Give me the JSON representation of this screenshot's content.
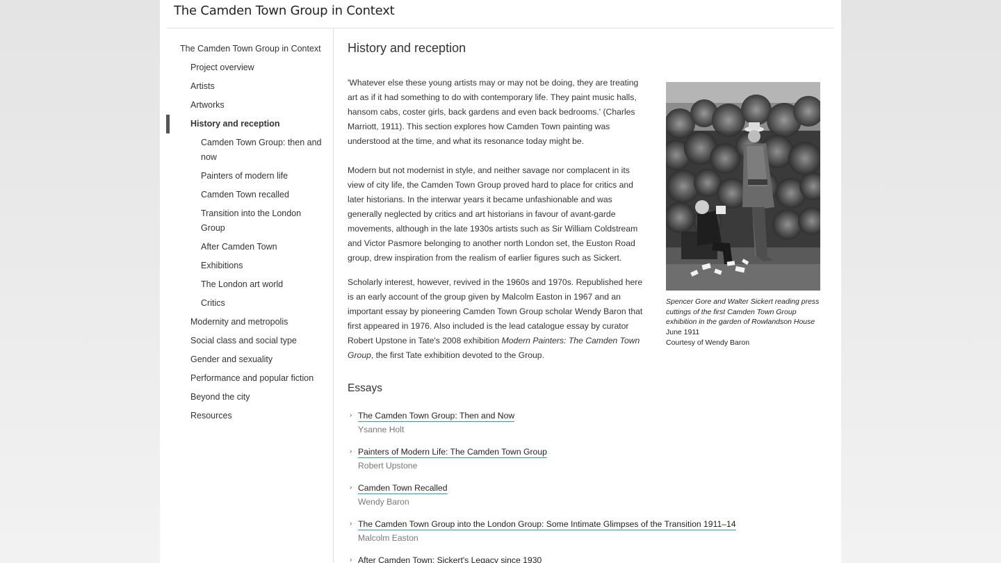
{
  "site": {
    "title": "The Camden Town Group in Context"
  },
  "sidebar": {
    "items": [
      {
        "label": "The Camden Town Group in Context",
        "level": 0
      },
      {
        "label": "Project overview",
        "level": 1
      },
      {
        "label": "Artists",
        "level": 1
      },
      {
        "label": "Artworks",
        "level": 1
      },
      {
        "label": "History and reception",
        "level": 1,
        "active": true
      },
      {
        "label": "Camden Town Group: then and now",
        "level": 2
      },
      {
        "label": "Painters of modern life",
        "level": 2
      },
      {
        "label": "Camden Town recalled",
        "level": 2
      },
      {
        "label": "Transition into the London Group",
        "level": 2
      },
      {
        "label": "After Camden Town",
        "level": 2
      },
      {
        "label": "Exhibitions",
        "level": 2
      },
      {
        "label": "The London art world",
        "level": 2
      },
      {
        "label": "Critics",
        "level": 2
      },
      {
        "label": "Modernity and metropolis",
        "level": 1
      },
      {
        "label": "Social class and social type",
        "level": 1
      },
      {
        "label": "Gender and sexuality",
        "level": 1
      },
      {
        "label": "Performance and popular fiction",
        "level": 1
      },
      {
        "label": "Beyond the city",
        "level": 1
      },
      {
        "label": "Resources",
        "level": 1
      }
    ]
  },
  "main": {
    "heading": "History and reception",
    "paragraphs": {
      "p1": "'Whatever else these young artists may or may not be doing, they are treating art as if it had something to do with contemporary life. They paint music halls, hansom cabs, coster girls, back gardens and even back bedrooms.' (Charles Marriott, 1911). This section explores how Camden Town painting was understood at the time, and what its resonance today might be.",
      "p2": "Modern but not modernist in style, and neither savage nor complacent in its view of city life, the Camden Town Group proved hard to place for critics and later historians. In the interwar years it became unfashionable and was generally neglected by critics and art historians in favour of avant-garde movements, although in the late 1930s artists such as Sir William Coldstream and Victor Pasmore belonging to another north London set, the Euston Road group, drew inspiration from the realism of earlier figures such as Sickert.",
      "p3_before": "Scholarly interest, however, revived in the 1960s and 1970s. Republished here is an early account of the group given by Malcolm Easton in 1967 and an important essay by pioneering Camden Town Group scholar Wendy Baron that first appeared in 1976. Also included is the lead catalogue essay by curator Robert Upstone in Tate's 2008 exhibition ",
      "p3_italic": "Modern Painters: The Camden Town Group",
      "p3_after": ", the first Tate exhibition devoted to the Group."
    },
    "figure": {
      "caption_italic": "Spencer Gore and Walter Sickert reading press cuttings of the first Camden Town Group exhibition in the garden of Rowlandson House",
      "caption_date": " June 1911",
      "credit": "Courtesy of Wendy Baron"
    },
    "essays_heading": "Essays",
    "essays": [
      {
        "title": "The Camden Town Group: Then and Now",
        "author": "Ysanne Holt"
      },
      {
        "title": "Painters of Modern Life: The Camden Town Group",
        "author": "Robert Upstone"
      },
      {
        "title": "Camden Town Recalled",
        "author": "Wendy Baron"
      },
      {
        "title": "The Camden Town Group into the London Group: Some Intimate Glimpses of the Transition 1911–14",
        "author": "Malcolm Easton"
      },
      {
        "title": "After Camden Town: Sickert's Legacy since 1930",
        "author": ""
      }
    ]
  },
  "colors": {
    "link_underline": "#2a9bb8",
    "active_marker": "#555555",
    "background": "#e8e8e8"
  }
}
